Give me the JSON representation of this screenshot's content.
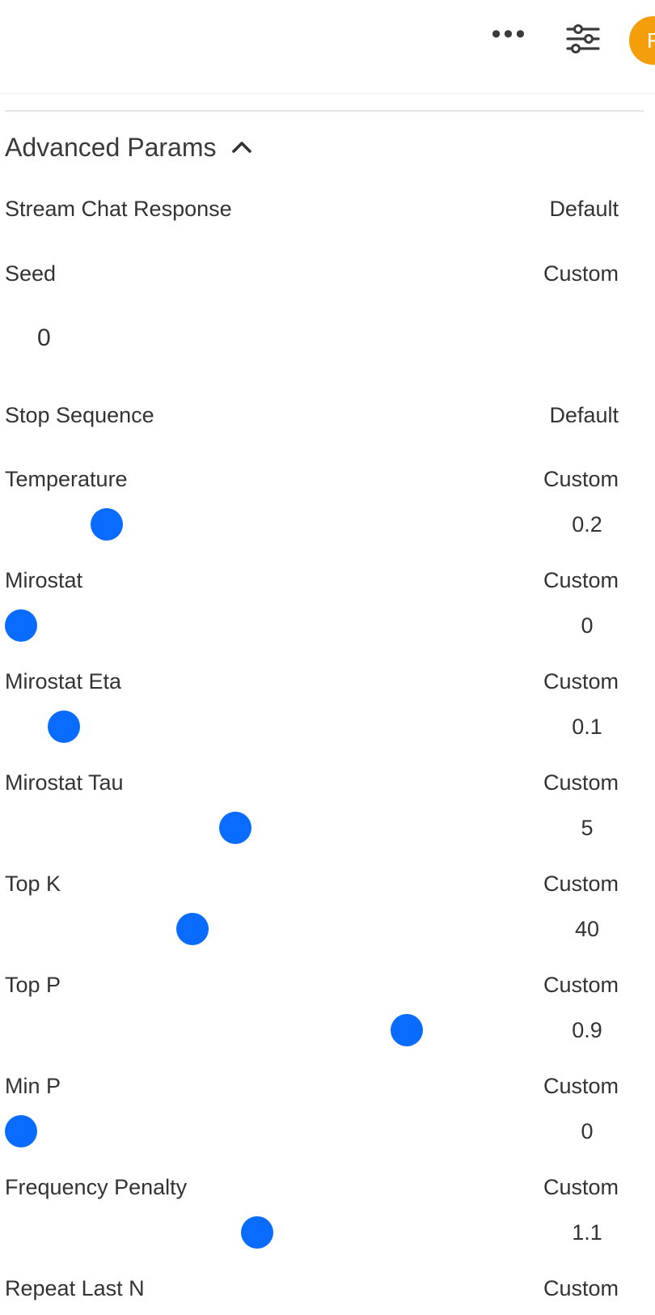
{
  "header": {
    "more_icon": "more-horizontal-icon",
    "controls_icon": "sliders-icon",
    "avatar_initial": "F",
    "avatar_color": "#f59e0b"
  },
  "section": {
    "title": "Advanced Params",
    "toggle_icon": "chevron-up-icon"
  },
  "accent_color": "#0a6cff",
  "params": {
    "stream": {
      "label": "Stream Chat Response",
      "mode": "Default"
    },
    "seed": {
      "label": "Seed",
      "mode": "Custom",
      "value": "0"
    },
    "stop": {
      "label": "Stop Sequence",
      "mode": "Default"
    },
    "temperature": {
      "label": "Temperature",
      "mode": "Custom",
      "value": "0.2",
      "fraction": 0.2
    },
    "mirostat": {
      "label": "Mirostat",
      "mode": "Custom",
      "value": "0",
      "fraction": 0.0
    },
    "mirostat_eta": {
      "label": "Mirostat Eta",
      "mode": "Custom",
      "value": "0.1",
      "fraction": 0.1
    },
    "mirostat_tau": {
      "label": "Mirostat Tau",
      "mode": "Custom",
      "value": "5",
      "fraction": 0.5
    },
    "top_k": {
      "label": "Top K",
      "mode": "Custom",
      "value": "40",
      "fraction": 0.4
    },
    "top_p": {
      "label": "Top P",
      "mode": "Custom",
      "value": "0.9",
      "fraction": 0.9
    },
    "min_p": {
      "label": "Min P",
      "mode": "Custom",
      "value": "0",
      "fraction": 0.0
    },
    "frequency_penalty": {
      "label": "Frequency Penalty",
      "mode": "Custom",
      "value": "1.1",
      "fraction": 0.55
    },
    "repeat_last_n": {
      "label": "Repeat Last N",
      "mode": "Custom"
    }
  }
}
